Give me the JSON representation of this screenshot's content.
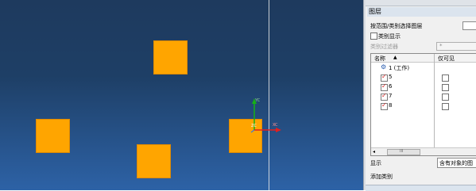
{
  "panel": {
    "section_title": "图层",
    "select_by_label": "按范围/类别选择图层",
    "category_display_label": "类别显示",
    "category_filter_label": "类别过滤器",
    "category_filter_value": "*",
    "tree": {
      "col_name": "名称",
      "col_visible": "仅可见",
      "rows": [
        {
          "label": "1 (工作)",
          "checked": true,
          "work": true
        },
        {
          "label": "5",
          "checked": true
        },
        {
          "label": "6",
          "checked": true
        },
        {
          "label": "7",
          "checked": true
        },
        {
          "label": "8",
          "checked": true
        }
      ],
      "scroll_grip": "III"
    },
    "display_label": "显示",
    "display_value": "含有对象的图",
    "add_category_label": "添加类别"
  },
  "triad": {
    "y_label": "YC",
    "z_label": "ZC",
    "x_label": "XC"
  },
  "colors": {
    "square": "#ffa500",
    "bg_top": "#1e3a5e",
    "bg_bottom": "#2d62a6"
  }
}
